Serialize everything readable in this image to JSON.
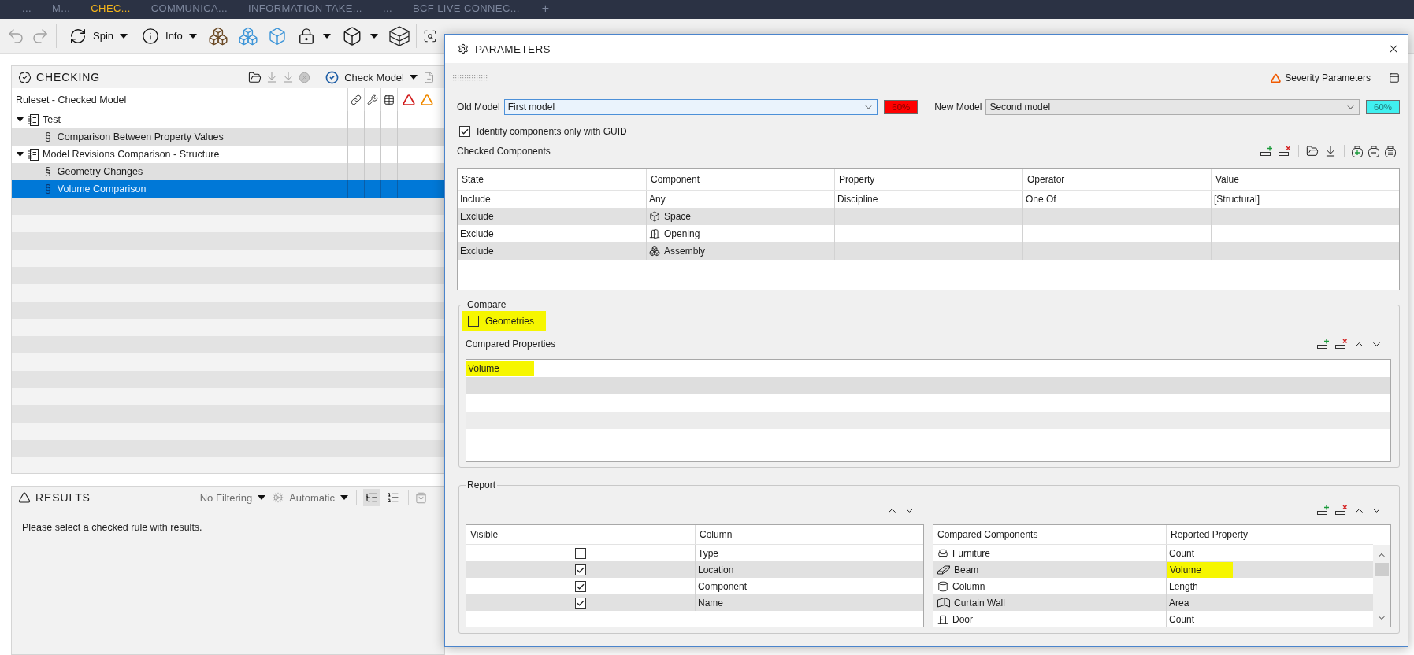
{
  "app_tabs": [
    {
      "label": "...",
      "selected": false
    },
    {
      "label": "M...",
      "selected": false
    },
    {
      "label": "CHEC...",
      "selected": true
    },
    {
      "label": "COMMUNICA...",
      "selected": false
    },
    {
      "label": "INFORMATION TAKE...",
      "selected": false
    },
    {
      "label": "...",
      "selected": false
    },
    {
      "label": "BCF LIVE CONNEC...",
      "selected": false
    }
  ],
  "add_tab": "+",
  "toolbar": {
    "spin": "Spin",
    "info": "Info"
  },
  "checking": {
    "title": "CHECKING",
    "check_model": "Check Model",
    "tree_header": "Ruleset - Checked Model",
    "rules": [
      {
        "kind": "ruleset",
        "label": "Test",
        "expanded": true,
        "selected": false,
        "children": [
          {
            "kind": "rule",
            "symbol": "§",
            "label": "Comparison Between Property Values",
            "selected": false
          }
        ]
      },
      {
        "kind": "ruleset",
        "label": "Model Revisions Comparison - Structure",
        "expanded": true,
        "selected": false,
        "children": [
          {
            "kind": "rule",
            "symbol": "§",
            "label": "Geometry Changes",
            "selected": false
          },
          {
            "kind": "rule",
            "symbol": "§",
            "label": "Volume Comparison",
            "selected": true
          }
        ]
      }
    ]
  },
  "results": {
    "title": "RESULTS",
    "filter": "No Filtering",
    "mode": "Automatic",
    "view_modes": [
      {
        "kind": "tree",
        "selected": true
      },
      {
        "kind": "list",
        "selected": false
      }
    ],
    "message": "Please select a checked rule with results."
  },
  "parameters": {
    "title": "PARAMETERS",
    "severity_parameters": "Severity Parameters",
    "models": [
      {
        "label": "Old Model",
        "value": "First model",
        "badge": "60%",
        "color": "#ff0000",
        "focused": true
      },
      {
        "label": "New Model",
        "value": "Second model",
        "badge": "60%",
        "color": "#40f0f0",
        "focused": false
      }
    ],
    "identify_by_guid": {
      "label": "Identify components only with GUID",
      "checked": true
    },
    "checked_components": {
      "title": "Checked Components",
      "columns": [
        "State",
        "Component",
        "Property",
        "Operator",
        "Value"
      ],
      "rows": [
        {
          "state": "Include",
          "kind": "any",
          "component": "Any",
          "property": "Discipline",
          "operator": "One Of",
          "value": "[Structural]"
        },
        {
          "state": "Exclude",
          "kind": "space",
          "component": "Space"
        },
        {
          "state": "Exclude",
          "kind": "opening",
          "component": "Opening"
        },
        {
          "state": "Exclude",
          "kind": "assembly",
          "component": "Assembly"
        }
      ]
    },
    "compare": {
      "title": "Compare",
      "geometries": {
        "label": "Geometries",
        "checked": false,
        "highlighted": true
      },
      "properties_title": "Compared Properties",
      "properties": [
        {
          "label": "Volume",
          "highlighted": true
        }
      ]
    },
    "report": {
      "title": "Report",
      "columns_table": {
        "columns": [
          "Visible",
          "Column"
        ],
        "rows": [
          {
            "visible": false,
            "column": "Type"
          },
          {
            "visible": true,
            "column": "Location"
          },
          {
            "visible": true,
            "column": "Component"
          },
          {
            "visible": true,
            "column": "Name"
          }
        ]
      },
      "components_table": {
        "columns": [
          "Compared Components",
          "Reported Property"
        ],
        "rows": [
          {
            "kind": "furniture",
            "component": "Furniture",
            "property": "Count",
            "highlighted": false
          },
          {
            "kind": "beam",
            "component": "Beam",
            "property": "Volume",
            "highlighted": true
          },
          {
            "kind": "column",
            "component": "Column",
            "property": "Length",
            "highlighted": false
          },
          {
            "kind": "curtain_wall",
            "component": "Curtain Wall",
            "property": "Area",
            "highlighted": false
          },
          {
            "kind": "door",
            "component": "Door",
            "property": "Count",
            "highlighted": false
          }
        ]
      }
    }
  }
}
